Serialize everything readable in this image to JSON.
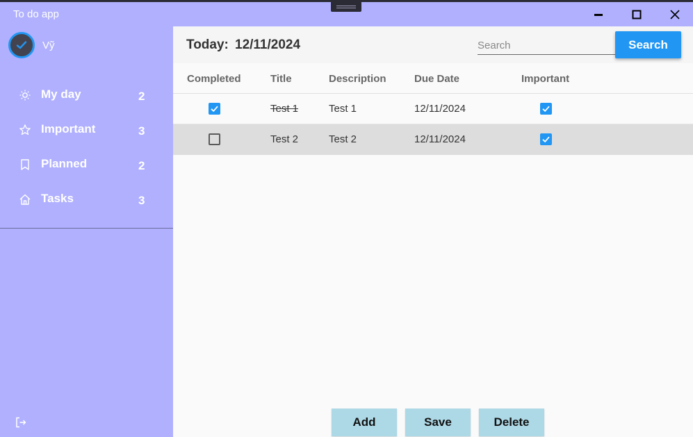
{
  "window": {
    "title": "To do app"
  },
  "user": {
    "name": "Vỹ"
  },
  "sidebar": {
    "items": [
      {
        "label": "My day",
        "count": "2",
        "icon": "sun-icon"
      },
      {
        "label": "Important",
        "count": "3",
        "icon": "star-icon"
      },
      {
        "label": "Planned",
        "count": "2",
        "icon": "bookmark-icon"
      },
      {
        "label": "Tasks",
        "count": "3",
        "icon": "home-icon"
      }
    ]
  },
  "header": {
    "today_label": "Today:",
    "today_date": "12/11/2024",
    "search_placeholder": "Search",
    "search_button": "Search"
  },
  "table": {
    "columns": [
      "Completed",
      "Title",
      "Description",
      "Due Date",
      "Important"
    ],
    "rows": [
      {
        "completed": true,
        "title": "Test 1",
        "description": "Test 1",
        "due": "12/11/2024",
        "important": true
      },
      {
        "completed": false,
        "title": "Test 2",
        "description": "Test 2",
        "due": "12/11/2024",
        "important": true
      }
    ]
  },
  "actions": {
    "add": "Add",
    "save": "Save",
    "delete": "Delete"
  },
  "colors": {
    "sidebar": "#b0b0ff",
    "accent": "#2196f3",
    "button": "#add8e6",
    "selected_row": "#dddddd"
  }
}
